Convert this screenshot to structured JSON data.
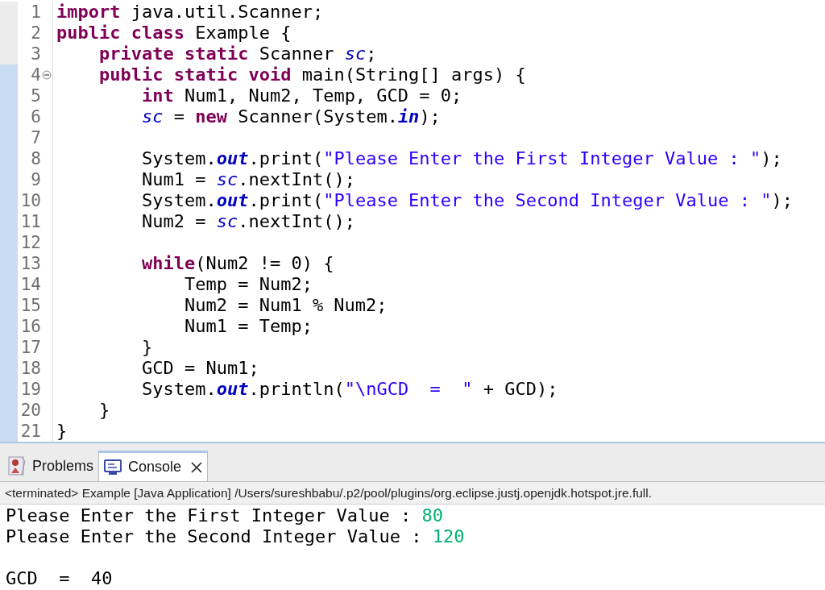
{
  "editor": {
    "lines": [
      {
        "number": "1",
        "marked": false,
        "tokens": [
          {
            "text": "import",
            "kind": "keyword"
          },
          {
            "text": " java.util.Scanner;",
            "kind": "plain"
          }
        ]
      },
      {
        "number": "2",
        "marked": false,
        "tokens": [
          {
            "text": "public class",
            "kind": "keyword"
          },
          {
            "text": " Example {",
            "kind": "plain"
          }
        ]
      },
      {
        "number": "3",
        "marked": false,
        "tokens": [
          {
            "text": "    private static",
            "kind": "keyword"
          },
          {
            "text": " Scanner ",
            "kind": "plain"
          },
          {
            "text": "sc",
            "kind": "field"
          },
          {
            "text": ";",
            "kind": "plain"
          }
        ]
      },
      {
        "number": "4",
        "marked": true,
        "expanded": true,
        "tokens": [
          {
            "text": "    public static void",
            "kind": "keyword"
          },
          {
            "text": " main(String[] args) {",
            "kind": "plain"
          }
        ]
      },
      {
        "number": "5",
        "marked": true,
        "tokens": [
          {
            "text": "        int",
            "kind": "keyword"
          },
          {
            "text": " Num1, Num2, Temp, GCD = 0;",
            "kind": "plain"
          }
        ]
      },
      {
        "number": "6",
        "marked": true,
        "tokens": [
          {
            "text": "        sc",
            "kind": "field"
          },
          {
            "text": " = ",
            "kind": "plain"
          },
          {
            "text": "new",
            "kind": "keyword"
          },
          {
            "text": " Scanner(System.",
            "kind": "plain"
          },
          {
            "text": "in",
            "kind": "static"
          },
          {
            "text": ");",
            "kind": "plain"
          }
        ]
      },
      {
        "number": "7",
        "marked": true
      },
      {
        "number": "8",
        "marked": true,
        "tokens": [
          {
            "text": "        System.",
            "kind": "plain"
          },
          {
            "text": "out",
            "kind": "static"
          },
          {
            "text": ".print(",
            "kind": "plain"
          },
          {
            "text": "\"Please Enter the First Integer Value : \"",
            "kind": "string"
          },
          {
            "text": ");",
            "kind": "plain"
          }
        ]
      },
      {
        "number": "9",
        "marked": true,
        "tokens": [
          {
            "text": "        Num1 = ",
            "kind": "plain"
          },
          {
            "text": "sc",
            "kind": "field"
          },
          {
            "text": ".nextInt();",
            "kind": "plain"
          }
        ]
      },
      {
        "number": "10",
        "marked": true,
        "tokens": [
          {
            "text": "        System.",
            "kind": "plain"
          },
          {
            "text": "out",
            "kind": "static"
          },
          {
            "text": ".print(",
            "kind": "plain"
          },
          {
            "text": "\"Please Enter the Second Integer Value : \"",
            "kind": "string"
          },
          {
            "text": ");",
            "kind": "plain"
          }
        ]
      },
      {
        "number": "11",
        "marked": true,
        "tokens": [
          {
            "text": "        Num2 = ",
            "kind": "plain"
          },
          {
            "text": "sc",
            "kind": "field"
          },
          {
            "text": ".nextInt();",
            "kind": "plain"
          }
        ]
      },
      {
        "number": "12",
        "marked": true
      },
      {
        "number": "13",
        "marked": true,
        "tokens": [
          {
            "text": "        while",
            "kind": "keyword"
          },
          {
            "text": "(Num2 != 0) {",
            "kind": "plain"
          }
        ]
      },
      {
        "number": "14",
        "marked": true,
        "tokens": [
          {
            "text": "            Temp = Num2;",
            "kind": "plain"
          }
        ]
      },
      {
        "number": "15",
        "marked": true,
        "tokens": [
          {
            "text": "            Num2 = Num1 % Num2;",
            "kind": "plain"
          }
        ]
      },
      {
        "number": "16",
        "marked": true,
        "tokens": [
          {
            "text": "            Num1 = Temp;",
            "kind": "plain"
          }
        ]
      },
      {
        "number": "17",
        "marked": true,
        "tokens": [
          {
            "text": "        }",
            "kind": "plain"
          }
        ]
      },
      {
        "number": "18",
        "marked": true,
        "tokens": [
          {
            "text": "        GCD = Num1;",
            "kind": "plain"
          }
        ]
      },
      {
        "number": "19",
        "marked": true,
        "tokens": [
          {
            "text": "        System.",
            "kind": "plain"
          },
          {
            "text": "out",
            "kind": "static"
          },
          {
            "text": ".println(",
            "kind": "plain"
          },
          {
            "text": "\"\\nGCD  =  \"",
            "kind": "string"
          },
          {
            "text": " + GCD);",
            "kind": "plain"
          }
        ]
      },
      {
        "number": "20",
        "marked": true,
        "tokens": [
          {
            "text": "    }",
            "kind": "plain"
          }
        ]
      },
      {
        "number": "21",
        "marked": true,
        "tokens": [
          {
            "text": "}",
            "kind": "plain"
          }
        ]
      }
    ]
  },
  "tabs": [
    {
      "label": "Problems",
      "kind": "problems",
      "selected": false
    },
    {
      "label": "Console",
      "kind": "console",
      "selected": true,
      "closable": true
    }
  ],
  "console": {
    "header": "<terminated> Example [Java Application] /Users/sureshbabu/.p2/pool/plugins/org.eclipse.justj.openjdk.hotspot.jre.full.",
    "lines": [
      {
        "kind": "text",
        "segments": [
          {
            "text": "Please Enter the First Integer Value : ",
            "kind": "output"
          },
          {
            "text": "80",
            "kind": "input"
          }
        ]
      },
      {
        "kind": "text",
        "segments": [
          {
            "text": "Please Enter the Second Integer Value : ",
            "kind": "output"
          },
          {
            "text": "120",
            "kind": "input"
          }
        ]
      },
      {
        "kind": "blank"
      },
      {
        "kind": "text",
        "segments": [
          {
            "text": "GCD  =  40",
            "kind": "output"
          }
        ]
      }
    ]
  }
}
